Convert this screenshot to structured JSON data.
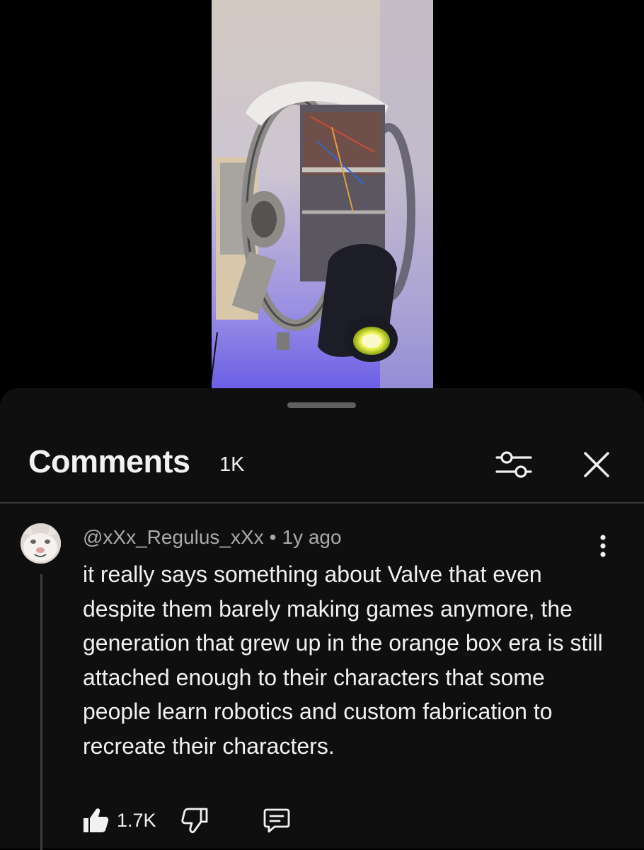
{
  "video": {
    "description_icon": "robot-video-frame"
  },
  "comments_panel": {
    "title": "Comments",
    "count": "1K",
    "filter_icon": "sliders-icon",
    "close_icon": "close-icon"
  },
  "comment": {
    "author": "@xXx_Regulus_xXx",
    "separator": "•",
    "time": "1y ago",
    "text": "it really says something about Valve that even despite them barely making games anymore, the generation that grew up in the orange box era is still attached enough to their characters that some people learn robotics and custom fabrication to recreate their characters.",
    "likes": "1.7K",
    "like_icon": "thumbs-up-icon",
    "dislike_icon": "thumbs-down-icon",
    "reply_icon": "reply-icon",
    "more_icon": "more-vertical-icon"
  }
}
